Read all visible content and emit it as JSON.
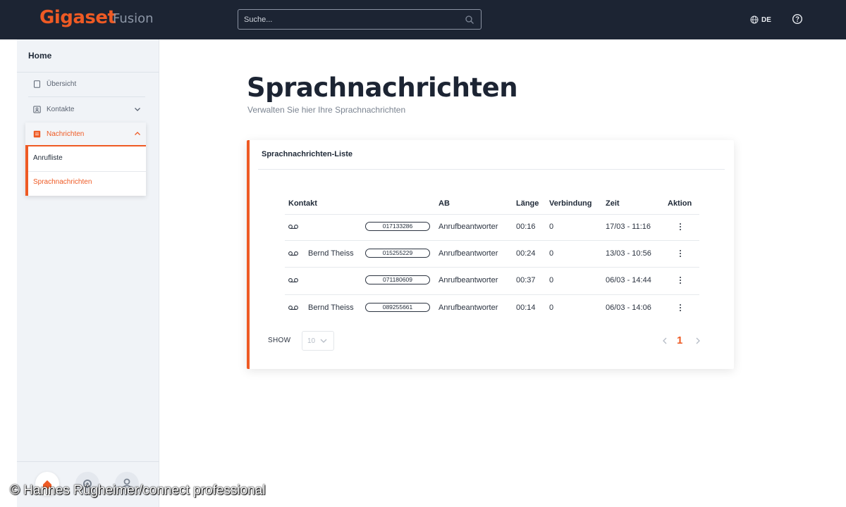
{
  "header": {
    "logo": "Gigaset",
    "logo_sub": "Fusion",
    "search_placeholder": "Suche...",
    "language": "DE",
    "colors": {
      "background": "#1c2433",
      "accent": "#ee5a24",
      "sub": "#8c96a6"
    }
  },
  "sidebar": {
    "home": "Home",
    "items": [
      {
        "label": "Übersicht",
        "icon": "overview-icon"
      },
      {
        "label": "Kontakte",
        "icon": "contacts-icon"
      },
      {
        "label": "Nachrichten",
        "icon": "messages-icon"
      }
    ],
    "subitems": [
      {
        "label": "Anrufliste",
        "active": false
      },
      {
        "label": "Sprachnachrichten",
        "active": true
      }
    ],
    "bottom_icons": [
      "home-icon",
      "settings-icon",
      "user-icon"
    ]
  },
  "page": {
    "title": "Sprachnachrichten",
    "subtitle": "Verwalten Sie hier Ihre Sprachnachrichten"
  },
  "card": {
    "title": "Sprachnachrichten-Liste",
    "columns": [
      "Kontakt",
      "AB",
      "Länge",
      "Verbindung",
      "Zeit",
      "Aktion"
    ],
    "rows": [
      {
        "name": "",
        "number": "017133286",
        "ab": "Anrufbeantworter",
        "length": "00:16",
        "connection": "0",
        "time": "17/03 - 11:16"
      },
      {
        "name": "Bernd Theiss",
        "number": "015255229",
        "ab": "Anrufbeantworter",
        "length": "00:24",
        "connection": "0",
        "time": "13/03 - 10:56"
      },
      {
        "name": "",
        "number": "071180609",
        "ab": "Anrufbeantworter",
        "length": "00:37",
        "connection": "0",
        "time": "06/03 - 14:44"
      },
      {
        "name": "Bernd Theiss",
        "number": "089255661",
        "ab": "Anrufbeantworter",
        "length": "00:14",
        "connection": "0",
        "time": "06/03 - 14:06"
      }
    ],
    "show_label": "SHOW",
    "show_value": "10",
    "current_page": "1"
  },
  "watermark": "© Hannes Rügheimer/connect professional"
}
